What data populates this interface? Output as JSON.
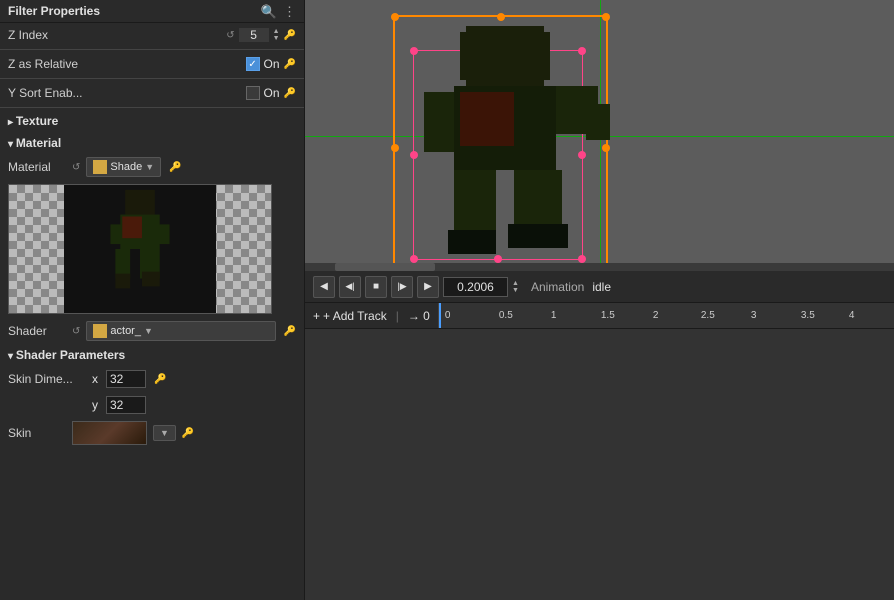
{
  "panel": {
    "title": "Filter Properties",
    "search_icon": "🔍",
    "settings_icon": "⚙",
    "z_index": {
      "label": "Z Index",
      "value": "5",
      "reset_icon": "↺",
      "key_icon": "🔑"
    },
    "z_as_relative": {
      "label": "Z as Relative",
      "value": "On",
      "checked": true
    },
    "y_sort_enable": {
      "label": "Y Sort Enab...",
      "value": "On",
      "checked": false
    },
    "texture_header": "Texture",
    "material_header": "Material",
    "material": {
      "label": "Material",
      "reset_icon": "↺",
      "shader_name": "Shade",
      "key_icon": "🔑"
    },
    "shader": {
      "label": "Shader",
      "reset_icon": "↺",
      "shader_name": "actor_",
      "key_icon": "🔑"
    },
    "shader_params_header": "Shader Parameters",
    "skin_dimensions": {
      "label": "Skin Dime...",
      "x_value": "32",
      "y_value": "32",
      "key_icon": "🔑"
    },
    "skin": {
      "label": "Skin"
    }
  },
  "animation": {
    "prev_icon": "◀",
    "prev_frame_icon": "◀|",
    "stop_icon": "■",
    "next_frame_icon": "|▶",
    "play_icon": "▶",
    "time_value": "0.2006",
    "label": "Animation",
    "name": "idle",
    "add_track_label": "+ Add Track",
    "timeline_start": "→ 0",
    "ruler_marks": [
      {
        "value": "0",
        "pos": 0
      },
      {
        "value": "0.5",
        "pos": 1
      },
      {
        "value": "1",
        "pos": 2
      },
      {
        "value": "1.5",
        "pos": 3
      },
      {
        "value": "2",
        "pos": 4
      },
      {
        "value": "2.5",
        "pos": 5
      },
      {
        "value": "3",
        "pos": 6
      },
      {
        "value": "3.5",
        "pos": 7
      },
      {
        "value": "4",
        "pos": 8
      }
    ]
  }
}
